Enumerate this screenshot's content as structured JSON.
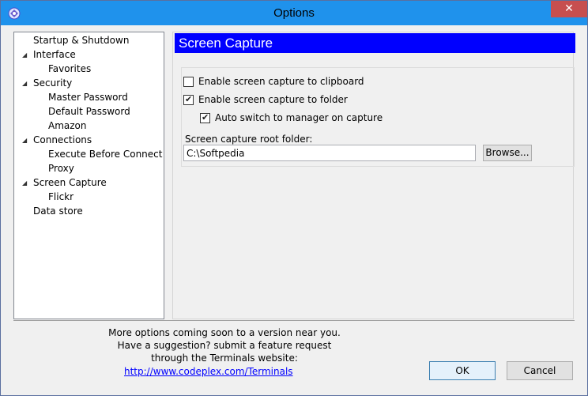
{
  "window": {
    "title": "Options",
    "close_glyph": "✕"
  },
  "tree": {
    "items": [
      {
        "label": "Startup & Shutdown",
        "expanded": null
      },
      {
        "label": "Interface",
        "expanded": true
      },
      {
        "label": "Favorites",
        "expanded": null
      },
      {
        "label": "Security",
        "expanded": true
      },
      {
        "label": "Master Password",
        "expanded": null
      },
      {
        "label": "Default Password",
        "expanded": null
      },
      {
        "label": "Amazon",
        "expanded": null
      },
      {
        "label": "Connections",
        "expanded": true
      },
      {
        "label": "Execute Before Connect",
        "expanded": null
      },
      {
        "label": "Proxy",
        "expanded": null
      },
      {
        "label": "Screen Capture",
        "expanded": true
      },
      {
        "label": "Flickr",
        "expanded": null
      },
      {
        "label": "Data store",
        "expanded": null
      }
    ]
  },
  "panel": {
    "header": "Screen Capture",
    "header_color": "#0000ff",
    "options": {
      "clipboard": {
        "label": "Enable screen capture to clipboard",
        "checked": false
      },
      "folder": {
        "label": "Enable screen capture to folder",
        "checked": true
      },
      "auto_switch": {
        "label": "Auto switch to manager on capture",
        "checked": true
      }
    },
    "root_folder_label": "Screen capture root folder:",
    "root_folder_value": "C:\\Softpedia",
    "browse_label": "Browse..."
  },
  "footer": {
    "line1": "More options coming soon to a version near you.",
    "line2": "Have a suggestion? submit a feature request",
    "line3": "through the Terminals website:",
    "link": "http://www.codeplex.com/Terminals"
  },
  "buttons": {
    "ok": "OK",
    "cancel": "Cancel"
  },
  "icons": {
    "app": "terminals-app-icon",
    "expander": "expanded-triangle-icon",
    "check": "checkmark-icon"
  }
}
